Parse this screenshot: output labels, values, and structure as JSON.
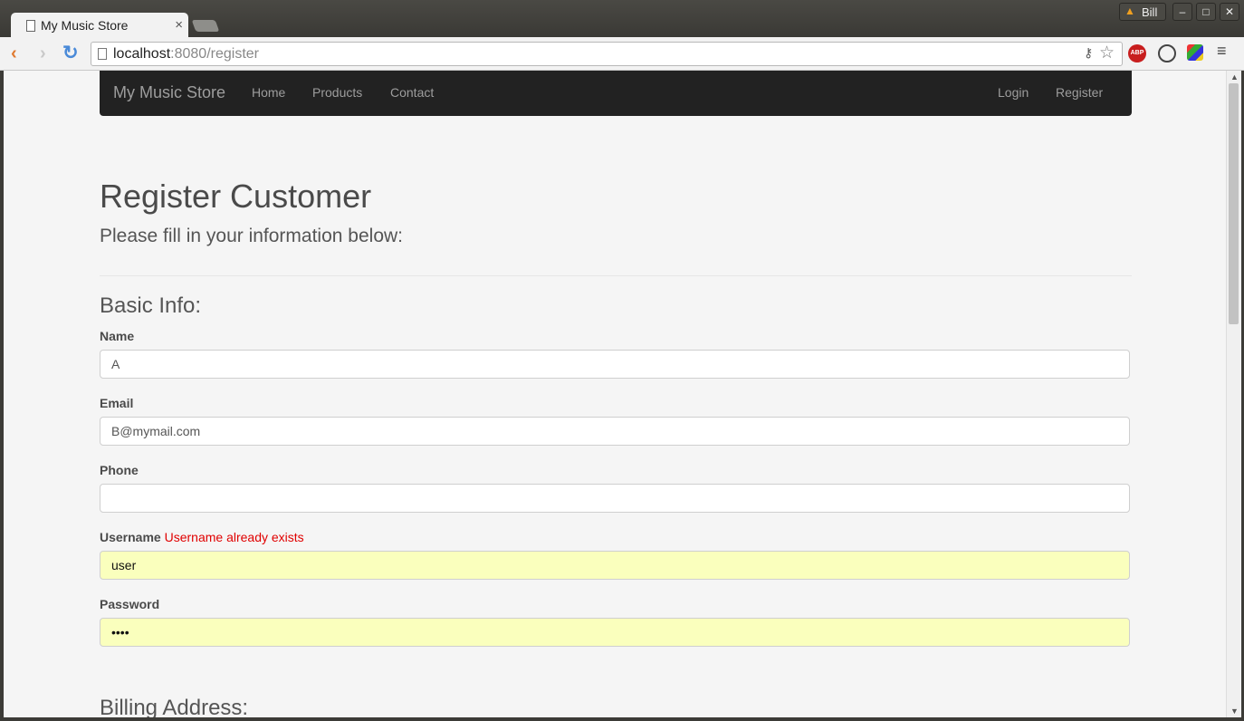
{
  "browser": {
    "tab_title": "My Music Store",
    "tab_close": "×",
    "user_name": "Bill",
    "url_host": "localhost",
    "url_rest": ":8080/register",
    "abp_label": "ABP"
  },
  "navbar": {
    "brand": "My Music Store",
    "links": [
      "Home",
      "Products",
      "Contact"
    ],
    "right_links": [
      "Login",
      "Register"
    ]
  },
  "page": {
    "title": "Register Customer",
    "lead": "Please fill in your information below:",
    "section_basic": "Basic Info:",
    "section_billing": "Billing Address:"
  },
  "form": {
    "name_label": "Name",
    "name_value": "A",
    "email_label": "Email",
    "email_value": "B@mymail.com",
    "phone_label": "Phone",
    "phone_value": "",
    "username_label": "Username",
    "username_error": "Username already exists",
    "username_value": "user",
    "password_label": "Password",
    "password_value": "••••"
  },
  "colors": {
    "navbar_bg": "#222222",
    "error": "#e00000",
    "autofill_bg": "#faffbd"
  }
}
